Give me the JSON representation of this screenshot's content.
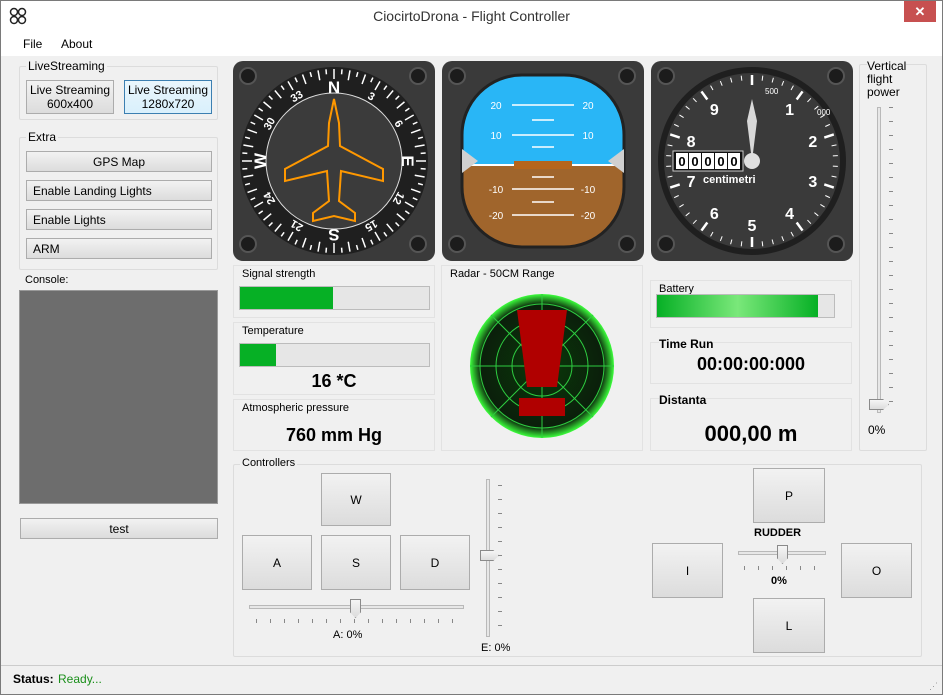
{
  "window": {
    "title": "CiocirtoDrona - Flight Controller",
    "close_glyph": "✕"
  },
  "menu": {
    "file": "File",
    "about": "About"
  },
  "livestreaming": {
    "label": "LiveStreaming",
    "btn_600": "Live Streaming\n600x400",
    "btn_1280": "Live Streaming\n1280x720"
  },
  "extra": {
    "label": "Extra",
    "gps": "GPS Map",
    "landing": "Enable Landing Lights",
    "lights": "Enable Lights",
    "arm": "ARM"
  },
  "console": {
    "label": "Console:",
    "test_btn": "test"
  },
  "compass": {
    "labels": [
      "N",
      "3",
      "6",
      "E",
      "12",
      "15",
      "S",
      "21",
      "24",
      "W",
      "30",
      "33"
    ]
  },
  "attitude": {
    "pitch_labels": [
      "20",
      "10",
      "-10",
      "-20"
    ]
  },
  "altimeter": {
    "digits": [
      "0",
      "0",
      "0",
      "0",
      "0"
    ],
    "unit": "centimetri",
    "sub500": "500",
    "sub1000": "000",
    "numbers": [
      "0",
      "1",
      "2",
      "3",
      "4",
      "5",
      "6",
      "7",
      "8",
      "9"
    ]
  },
  "signal": {
    "label": "Signal strength",
    "value": 0.49
  },
  "temperature": {
    "label": "Temperature",
    "value": 0.19,
    "text": "16 *C"
  },
  "pressure": {
    "label": "Atmospheric pressure",
    "text": "760 mm Hg"
  },
  "radar": {
    "label": "Radar - 50CM Range"
  },
  "battery": {
    "label": "Battery",
    "value": 0.91
  },
  "time_run": {
    "label": "Time Run",
    "value": "00:00:00:000"
  },
  "distanta": {
    "label": "Distanta",
    "value": "000,00 m"
  },
  "vertical": {
    "label": "Vertical\nflight\npower",
    "value_text": "0%"
  },
  "controllers": {
    "label": "Controllers",
    "w": "W",
    "a": "A",
    "s": "S",
    "d": "D",
    "a_text": "A: 0%",
    "e_text": "E: 0%",
    "p": "P",
    "i": "I",
    "o": "O",
    "l": "L",
    "rudder": "RUDDER",
    "rudder_value": "0%"
  },
  "status": {
    "label": "Status:",
    "value": "Ready..."
  },
  "colors": {
    "green": "#06b025",
    "sky": "#29b6f6",
    "ground": "#a0652c",
    "status_ok": "#1a8f1a"
  }
}
